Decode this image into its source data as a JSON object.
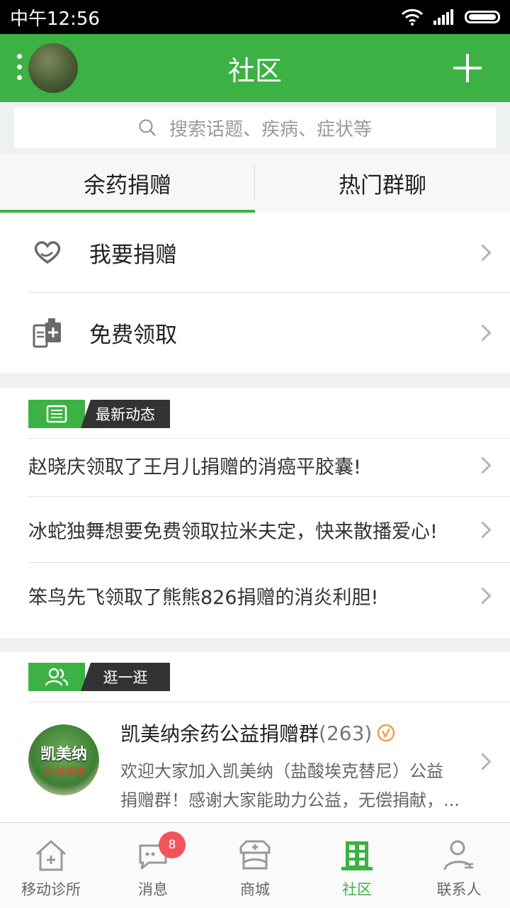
{
  "status_bar": {
    "time": "中午12:56"
  },
  "header": {
    "title": "社区"
  },
  "search": {
    "placeholder": "搜索话题、疾病、症状等"
  },
  "tabs": [
    {
      "label": "余药捐赠",
      "active": true
    },
    {
      "label": "热门群聊",
      "active": false
    }
  ],
  "menu": [
    {
      "label": "我要捐赠",
      "icon": "heart-hands-icon"
    },
    {
      "label": "免费领取",
      "icon": "medicine-bottle-icon"
    }
  ],
  "news": {
    "title": "最新动态",
    "items": [
      "赵晓庆领取了王月儿捐赠的消癌平胶囊!",
      "冰蛇独舞想要免费领取拉米夫定，快来散播爱心!",
      "笨鸟先飞领取了熊熊826捐赠的消炎利胆!"
    ]
  },
  "browse": {
    "title": "逛一逛",
    "group": {
      "logo_text": "凯美纳",
      "logo_subtext": "公益捐赠",
      "name": "凯美纳余药公益捐赠群",
      "count": "(263)",
      "description_line1": "欢迎大家加入凯美纳（盐酸埃克替尼）公益",
      "description_line2": "捐赠群！感谢大家能助力公益，无偿捐献，..."
    }
  },
  "bottom_nav": [
    {
      "label": "移动诊所",
      "icon": "clinic-icon"
    },
    {
      "label": "消息",
      "icon": "message-icon",
      "badge": "8"
    },
    {
      "label": "商城",
      "icon": "store-icon"
    },
    {
      "label": "社区",
      "icon": "community-icon",
      "active": true
    },
    {
      "label": "联系人",
      "icon": "contacts-icon"
    }
  ],
  "colors": {
    "brand_green": "#3bb243",
    "badge_red": "#f2545b",
    "verified_orange": "#f0a040"
  }
}
